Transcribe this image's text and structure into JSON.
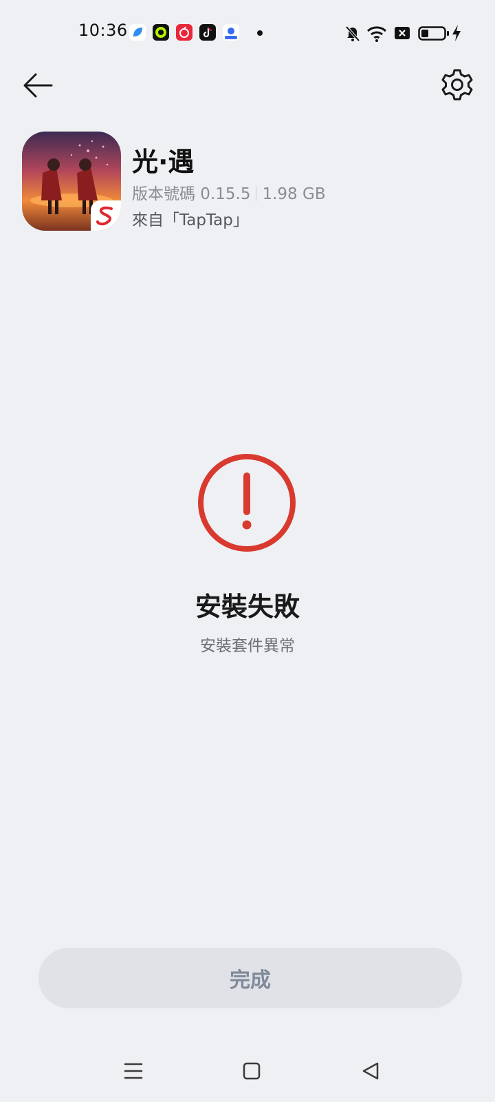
{
  "status_bar": {
    "time": "10:36",
    "notification_apps": [
      "blue-app-icon",
      "green-ring-app-icon",
      "netease-music-icon",
      "tiktok-icon",
      "baidu-icon"
    ],
    "system_icons": [
      "mute-bell-icon",
      "wifi-icon",
      "sim-x-icon",
      "battery-icon",
      "charging-bolt-icon"
    ],
    "battery_level": 0.3
  },
  "header": {
    "back_icon": "arrow-left-icon",
    "settings_icon": "gear-icon"
  },
  "app": {
    "name": "光·遇",
    "version_label": "版本號碼 0.15.5",
    "size": "1.98 GB",
    "source": "來自「TapTap」",
    "icon": "sky-game-icon",
    "badge": "netease-badge-icon"
  },
  "result": {
    "icon": "error-exclamation-icon",
    "accent_color": "#d93a2f",
    "title": "安裝失敗",
    "subtitle": "安裝套件異常"
  },
  "actions": {
    "done_label": "完成"
  },
  "nav_bar": [
    "menu-icon",
    "home-square-icon",
    "back-triangle-icon"
  ]
}
